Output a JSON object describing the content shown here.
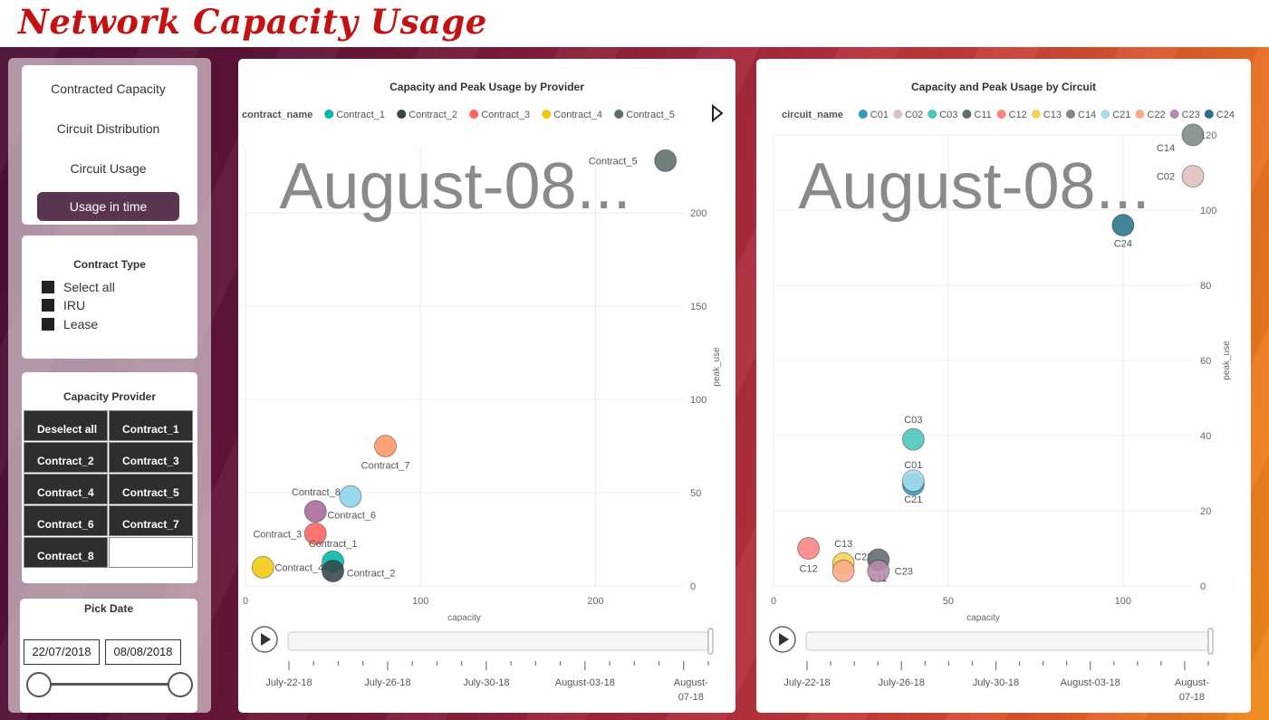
{
  "app": {
    "title": "Network Capacity Usage"
  },
  "nav": {
    "items": [
      "Contracted Capacity",
      "Circuit Distribution",
      "Circuit Usage",
      "Usage in time"
    ],
    "active": 3
  },
  "contract_type": {
    "title": "Contract Type",
    "options": [
      "Select all",
      "IRU",
      "Lease"
    ]
  },
  "capacity_provider": {
    "title": "Capacity Provider",
    "tiles": [
      "Deselect all",
      "Contract_1",
      "Contract_2",
      "Contract_3",
      "Contract_4",
      "Contract_5",
      "Contract_6",
      "Contract_7",
      "Contract_8"
    ]
  },
  "pick_date": {
    "title": "Pick Date",
    "start": "22/07/2018",
    "end": "08/08/2018"
  },
  "colors": {
    "accent": "#5a3550",
    "title_red": "#c41212"
  },
  "chart_data": [
    {
      "type": "scatter",
      "title": "Capacity and Peak Usage by Provider",
      "legend_title": "contract_name",
      "legend": [
        {
          "name": "Contract_1",
          "color": "#01b8aa"
        },
        {
          "name": "Contract_2",
          "color": "#374649"
        },
        {
          "name": "Contract_3",
          "color": "#fd625e"
        },
        {
          "name": "Contract_4",
          "color": "#f2c80f"
        },
        {
          "name": "Contract_5",
          "color": "#5f6b6d"
        }
      ],
      "watermark": "August-08...",
      "xlabel": "capacity",
      "ylabel": "peak_use",
      "xlim": [
        0,
        250
      ],
      "ylim": [
        0,
        235
      ],
      "xticks": [
        0,
        100,
        200
      ],
      "yticks": [
        0,
        50,
        100,
        150,
        200
      ],
      "points": [
        {
          "label": "Contract_5",
          "x": 240,
          "y": 228,
          "color": "#5f6b6d",
          "lx": -58,
          "ly": 4
        },
        {
          "label": "Contract_7",
          "x": 80,
          "y": 75,
          "color": "#fe9666",
          "lx": 0,
          "ly": 25
        },
        {
          "label": "Contract_8",
          "x": 60,
          "y": 48,
          "color": "#8ad4eb",
          "lx": -38,
          "ly": -1
        },
        {
          "label": "Contract_6",
          "x": 40,
          "y": 40,
          "color": "#a66999",
          "lx": 40,
          "ly": 8
        },
        {
          "label": "Contract_3",
          "x": 40,
          "y": 28,
          "color": "#fd625e",
          "lx": -42,
          "ly": 4
        },
        {
          "label": "Contract_1",
          "x": 50,
          "y": 13,
          "color": "#01b8aa",
          "lx": 0,
          "ly": -16
        },
        {
          "label": "Contract_4",
          "x": 10,
          "y": 10,
          "color": "#f2c80f",
          "lx": 40,
          "ly": 4
        },
        {
          "label": "Contract_2",
          "x": 50,
          "y": 8,
          "color": "#374649",
          "lx": 42,
          "ly": 6
        }
      ],
      "play_axis": {
        "ticks": [
          "July-22-18",
          "July-26-18",
          "July-30-18",
          "August-03-18",
          "August-07-18"
        ]
      }
    },
    {
      "type": "scatter",
      "title": "Capacity and Peak Usage by Circuit",
      "legend_title": "circuit_name",
      "legend": [
        {
          "name": "C01",
          "color": "#3599b8"
        },
        {
          "name": "C02",
          "color": "#dfbfbf"
        },
        {
          "name": "C03",
          "color": "#4ac5bb"
        },
        {
          "name": "C11",
          "color": "#5f6b6d"
        },
        {
          "name": "C12",
          "color": "#fb8281"
        },
        {
          "name": "C13",
          "color": "#f4d25a"
        },
        {
          "name": "C14",
          "color": "#7f898a"
        },
        {
          "name": "C21",
          "color": "#a4ddee"
        },
        {
          "name": "C22",
          "color": "#fdab89"
        },
        {
          "name": "C23",
          "color": "#b687ac"
        },
        {
          "name": "C24",
          "color": "#28738a"
        }
      ],
      "watermark": "August-08...",
      "xlabel": "capacity",
      "ylabel": "peak_use",
      "xlim": [
        0,
        120
      ],
      "ylim": [
        0,
        120
      ],
      "xticks": [
        0,
        50,
        100
      ],
      "yticks": [
        0,
        20,
        40,
        60,
        80,
        100,
        120
      ],
      "points": [
        {
          "label": "C14",
          "x": 120,
          "y": 120,
          "color": "#7f898a",
          "lx": -30,
          "ly": 18
        },
        {
          "label": "C02",
          "x": 120,
          "y": 109,
          "color": "#dfbfbf",
          "lx": -30,
          "ly": 4
        },
        {
          "label": "C24",
          "x": 100,
          "y": 96,
          "color": "#28738a",
          "lx": 0,
          "ly": 24
        },
        {
          "label": "C03",
          "x": 40,
          "y": 39,
          "color": "#4ac5bb",
          "lx": 0,
          "ly": -18
        },
        {
          "label": "C01",
          "x": 40,
          "y": 27,
          "color": "#3599b8",
          "lx": 0,
          "ly": -18
        },
        {
          "label": "C21",
          "x": 40,
          "y": 28,
          "color": "#a4ddee",
          "lx": 0,
          "ly": 24
        },
        {
          "label": "C12",
          "x": 10,
          "y": 10,
          "color": "#fb8281",
          "lx": 0,
          "ly": 26
        },
        {
          "label": "C13",
          "x": 20,
          "y": 6,
          "color": "#f4d25a",
          "lx": 0,
          "ly": -18
        },
        {
          "label": "C22",
          "x": 20,
          "y": 4,
          "color": "#fdab89",
          "lx": 22,
          "ly": -12
        },
        {
          "label": "C11",
          "x": 30,
          "y": 7,
          "color": "#5f6b6d",
          "lx": 0,
          "ly": 24
        },
        {
          "label": "C23",
          "x": 30,
          "y": 4,
          "color": "#b687ac",
          "lx": 28,
          "ly": 4
        }
      ],
      "play_axis": {
        "ticks": [
          "July-22-18",
          "July-26-18",
          "July-30-18",
          "August-03-18",
          "August-07-18"
        ]
      }
    }
  ]
}
